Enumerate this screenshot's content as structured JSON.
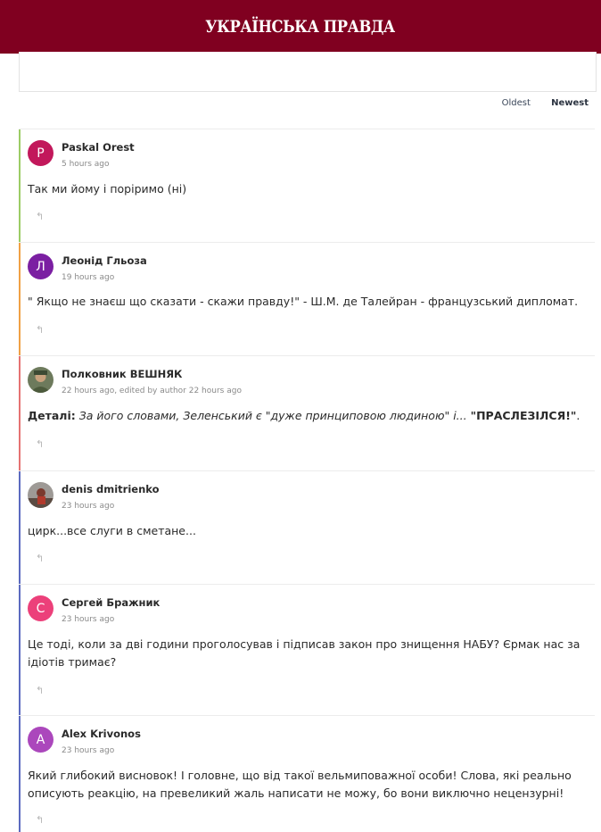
{
  "header": {
    "logo": "УКРАЇНСЬКА ПРАВДА"
  },
  "sort": {
    "oldest": "Oldest",
    "newest": "Newest"
  },
  "comments": [
    {
      "author": "Paskal Orest",
      "time": "5 hours ago",
      "initial": "P",
      "avatar_color": "#c2185b",
      "bar_color": "#9ccc65",
      "text": "Так ми йому і поріримо (ні)"
    },
    {
      "author": "Леонід Гльоза",
      "time": "19 hours ago",
      "initial": "Л",
      "avatar_color": "#7b1fa2",
      "bar_color": "#f0a045",
      "text": "\" Якщо не знаєш що сказати - скажи правду!\" - Ш.М. де Талейран - французський дипломат."
    },
    {
      "author": "Полковник ВЕШНЯК",
      "time": "22 hours ago, edited by author 22 hours ago",
      "bar_color": "#e57373",
      "text_lead": "Деталі:",
      "text_italic": "За його словами, Зеленський є \"дуже принциповою людиною\" і...",
      "text_bold": "\"ПРАСЛЕЗІЛСЯ!\"",
      "text_tail": "."
    },
    {
      "author": "denis dmitrienko",
      "time": "23 hours ago",
      "bar_color": "#5c6bc0",
      "text": "цирк...все слуги в сметане..."
    },
    {
      "author": "Сергей Бражник",
      "time": "23 hours ago",
      "initial": "С",
      "avatar_color": "#ec407a",
      "bar_color": "#5c6bc0",
      "text": "Це тоді, коли за дві години проголосував і підписав закон про знищення НАБУ? Єрмак нас за ідіотів тримає?"
    },
    {
      "author": "Alex Krivonos",
      "time": "23 hours ago",
      "initial": "A",
      "avatar_color": "#ab47bc",
      "bar_color": "#5c6bc0",
      "text": "Який глибокий висновок! І головне, що від такої вельмиповажної особи! Слова, які реально описують реакцію, на превеликий жаль написати не можу, бо вони виключно нецензурні!"
    }
  ],
  "icons": {
    "reply": "reply-arrow-icon"
  }
}
